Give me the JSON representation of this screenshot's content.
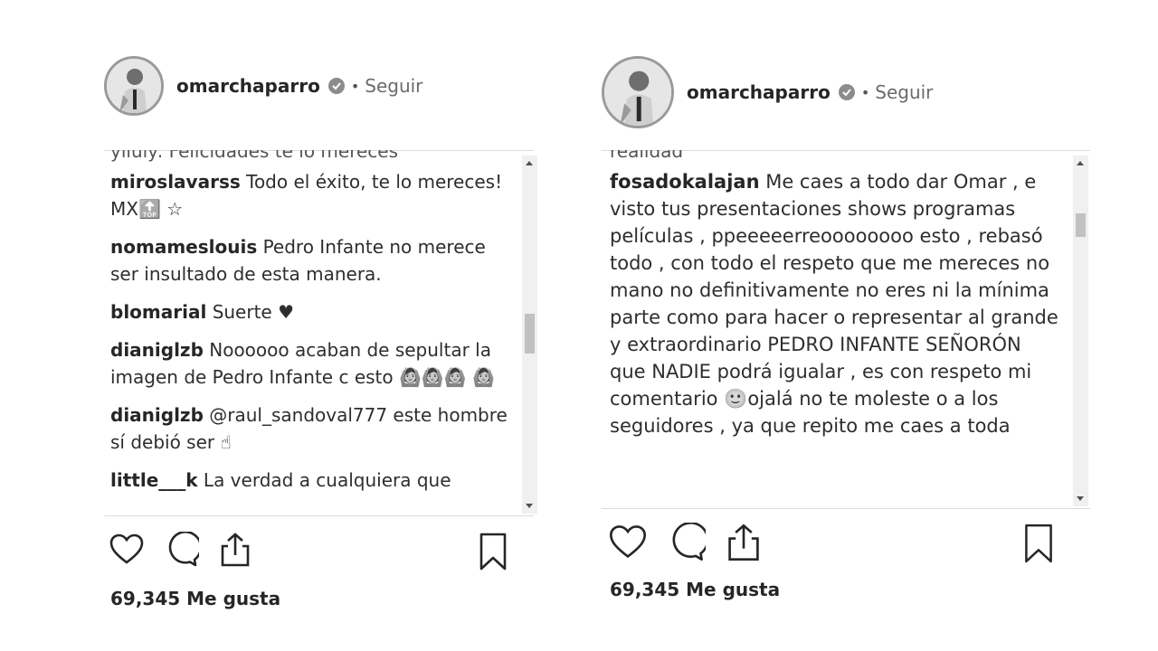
{
  "posts": [
    {
      "username": "omarchaparro",
      "follow_label": "Seguir",
      "separator": "•",
      "partial_top_comment": "yiluly: Felicidades te lo mereces",
      "comments": [
        {
          "user": "miroslavarss",
          "text": "Todo el éxito, te lo mereces! MX🔝 ☆"
        },
        {
          "user": "nomameslouis",
          "text": "Pedro Infante no merece ser insultado de esta manera."
        },
        {
          "user": "blomarial",
          "text": "Suerte ♥"
        },
        {
          "user": "dianiglzb",
          "text": "Noooooo acaban de sepultar la imagen de Pedro Infante c esto 🙆🙆🙆 🙆"
        },
        {
          "user": "dianiglzb",
          "text": "@raul_sandoval777 este hombre sí debió ser ☝"
        },
        {
          "user": "little___k",
          "text": "La verdad a cualquiera que"
        }
      ],
      "likes": "69,345 Me gusta"
    },
    {
      "username": "omarchaparro",
      "follow_label": "Seguir",
      "separator": "•",
      "partial_top_comment": "realidad",
      "comments": [
        {
          "user": "fosadokalajan",
          "text": "Me caes a todo dar Omar , e visto tus presentaciones shows programas películas , ppeeeeerreoooooooo esto , rebasó todo , con todo el respeto que me mereces no mano no definitivamente no eres ni la mínima parte como para hacer o representar al grande y extraordinario PEDRO INFANTE SEÑORÓN que NADIE podrá igualar , es con respeto mi comentario 🙂ojalá no te moleste o a los seguidores , ya que repito me caes a toda"
        }
      ],
      "likes": "69,345 Me gusta"
    }
  ],
  "icons": [
    "verified-badge-icon",
    "heart-icon",
    "comment-icon",
    "share-icon",
    "bookmark-icon"
  ]
}
